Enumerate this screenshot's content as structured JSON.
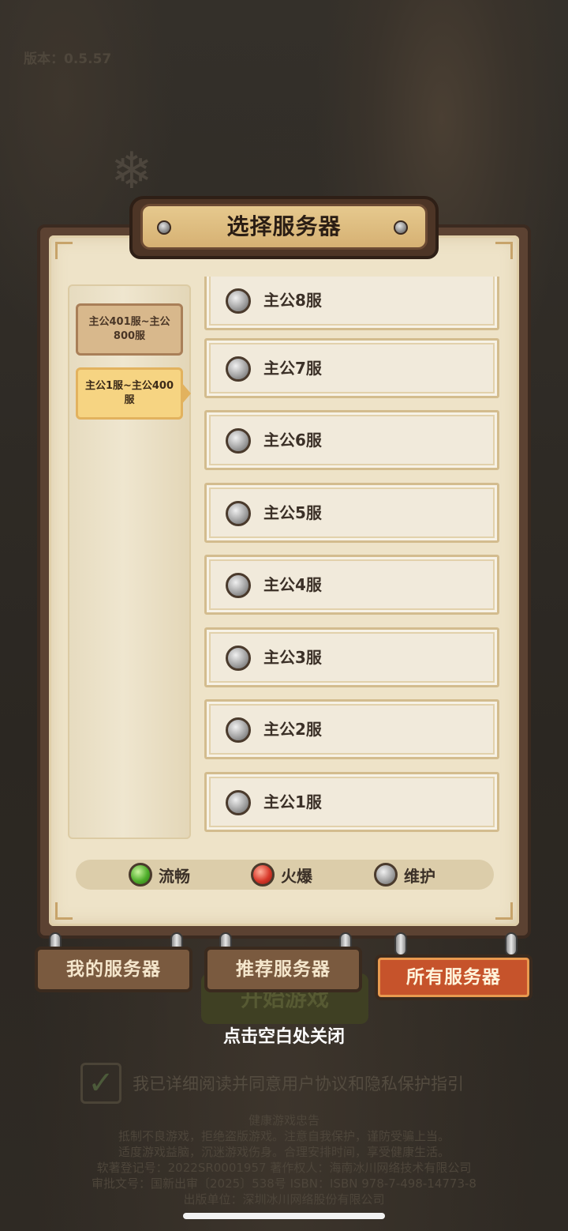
{
  "background": {
    "version_text": "版本：0.5.57",
    "start_button_label": "开始游戏",
    "agreement_text": "我已详细阅读并同意用户协议和隐私保护指引",
    "notice_lines": [
      "健康游戏忠告",
      "抵制不良游戏，拒绝盗版游戏。注意自我保护，谨防受骗上当。",
      "适度游戏益脑，沉迷游戏伤身。合理安排时间，享受健康生活。",
      "软著登记号：2022SR0001957   著作权人：海南冰川网络技术有限公司",
      "审批文号：国新出审〔2025〕538号   ISBN：ISBN 978-7-498-14773-8",
      "出版单位：深圳冰川网络股份有限公司"
    ]
  },
  "dialog": {
    "title": "选择服务器",
    "categories": [
      {
        "label": "主公401服~主公800服",
        "selected": false
      },
      {
        "label": "主公1服~主公400服",
        "selected": true
      }
    ],
    "servers": [
      {
        "name": "主公8服",
        "status": "maintenance"
      },
      {
        "name": "主公7服",
        "status": "maintenance"
      },
      {
        "name": "主公6服",
        "status": "maintenance"
      },
      {
        "name": "主公5服",
        "status": "maintenance"
      },
      {
        "name": "主公4服",
        "status": "maintenance"
      },
      {
        "name": "主公3服",
        "status": "maintenance"
      },
      {
        "name": "主公2服",
        "status": "maintenance"
      },
      {
        "name": "主公1服",
        "status": "maintenance"
      }
    ],
    "legend": [
      {
        "label": "流畅",
        "color": "#4fae2b"
      },
      {
        "label": "火爆",
        "color": "#d8382a"
      },
      {
        "label": "维护",
        "color": "#a3a3a3"
      }
    ],
    "tabs": [
      {
        "label": "我的服务器",
        "active": false
      },
      {
        "label": "推荐服务器",
        "active": false
      },
      {
        "label": "所有服务器",
        "active": true
      }
    ],
    "close_hint": "点击空白处关闭"
  },
  "colors": {
    "frame": "#5c4232",
    "parchment": "#eee3c8",
    "active_tab": "#c6532b",
    "active_category": "#f6d482"
  }
}
